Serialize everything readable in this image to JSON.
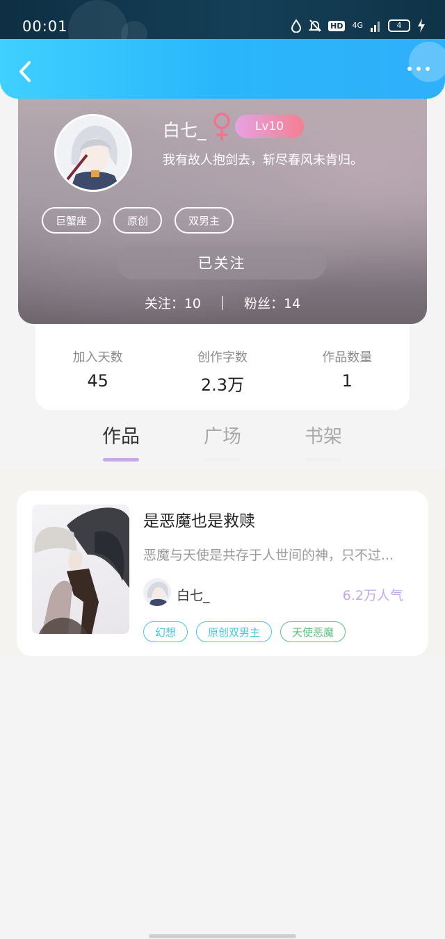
{
  "status_bar": {
    "time": "00:01",
    "network": "4G",
    "hd": "HD",
    "battery": "4"
  },
  "profile": {
    "username": "白七_",
    "level": "Lv10",
    "signature": "我有故人抱剑去，斩尽春风未肯归。",
    "tags": [
      "巨蟹座",
      "原创",
      "双男主"
    ],
    "follow_button": "已关注",
    "following": "关注：10",
    "fans": "粉丝：14"
  },
  "stats": [
    {
      "label": "加入天数",
      "value": "45"
    },
    {
      "label": "创作字数",
      "value": "2.3万"
    },
    {
      "label": "作品数量",
      "value": "1"
    }
  ],
  "tabs": [
    "作品",
    "广场",
    "书架"
  ],
  "work": {
    "title": "是恶魔也是救赎",
    "description": "恶魔与天使是共存于人世间的神，只不过...",
    "author": "白七_",
    "popularity": "6.2万人气",
    "tags": [
      {
        "label": "幻想",
        "color": "#41c8e6"
      },
      {
        "label": "原创双男主",
        "color": "#41c8e6"
      },
      {
        "label": "天使恶魔",
        "color": "#5cbf7a"
      }
    ]
  },
  "colors": {
    "nav_accent": "#2ab6fb",
    "level_gradient_start": "#e6a2e2",
    "level_gradient_end": "#f57e92",
    "tab_active": "#c4a8e8",
    "popularity": "#c4a8e8"
  }
}
